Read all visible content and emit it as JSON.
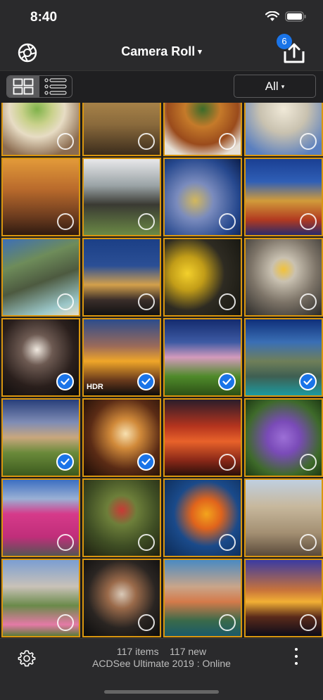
{
  "status_bar": {
    "time": "8:40"
  },
  "nav": {
    "title": "Camera Roll",
    "title_caret": "▾",
    "upload_badge": "6"
  },
  "toolbar": {
    "filter_label": "All",
    "filter_caret": "▾"
  },
  "colors": {
    "accent": "#1a74e8",
    "thumb_border": "#d9960f",
    "bar_bg": "#2a2a2c"
  },
  "thumbnails": [
    {
      "name": "salad",
      "bg": "radial-gradient(circle at 45% 40%, #7fb24a 0%, #c9d18b 25%, #e7dcc4 45%, #8b6b4f 80%)",
      "selected": false
    },
    {
      "name": "misty-temple",
      "bg": "linear-gradient(180deg, #c59b55 0%, #8a6a3c 60%, #3b2c1c 100%)",
      "selected": false
    },
    {
      "name": "noodles",
      "bg": "radial-gradient(circle at 50% 40%, #3b6b2a 0%, #c57a2a 30%, #9a4b1c 60%, #e6e0d6 85%)",
      "selected": false
    },
    {
      "name": "carved-wall",
      "bg": "radial-gradient(circle at 50% 40%, #f0e9d8 0%, #c9c2b0 40%, #5a7fbf 85%)",
      "selected": false
    },
    {
      "name": "khmer-temple",
      "bg": "linear-gradient(180deg, #e29a39 0%, #b96a2c 40%, #6e3d1f 75%, #2f1a10 100%)",
      "selected": false
    },
    {
      "name": "pagodas",
      "bg": "linear-gradient(180deg, #e8e8ea 0%, #9aa3a6 35%, #3a3a33 60%, #6b8a45 100%)",
      "selected": false
    },
    {
      "name": "coral",
      "bg": "radial-gradient(circle at 40% 55%, #d2b75d 0%, #7a8bbd 30%, #26488e 70%, #0c1e4a 100%)",
      "selected": false
    },
    {
      "name": "golden-temple",
      "bg": "linear-gradient(180deg, #1a3f93 0%, #2f5fb6 30%, #d19b3a 55%, #b23a20 80%, #2a2a6a 100%)",
      "selected": false
    },
    {
      "name": "cliffs-beach",
      "bg": "linear-gradient(160deg, #3d6fb5 0%, #6e8c5a 30%, #4d5a40 55%, #9bc7c9 85%, #e7ddc4 100%)",
      "selected": false
    },
    {
      "name": "city-night",
      "bg": "linear-gradient(180deg, #1b3f86 0%, #2b4f95 35%, #d3a04b 60%, #3a2e2a 80%, #111 100%)",
      "selected": false
    },
    {
      "name": "yellow-tulips",
      "bg": "radial-gradient(circle at 30% 45%, #f3d02c 0%, #c29d18 25%, #2e2b22 55%, #15150f 100%)",
      "selected": false
    },
    {
      "name": "owl",
      "bg": "radial-gradient(circle at 50% 40%, #f2c23a 0%, #c9c1b1 20%, #7d7468 55%, #2b2a28 100%)",
      "selected": false
    },
    {
      "name": "light-painting",
      "bg": "radial-gradient(circle at 45% 40%, #f0e9e0 0%, #6d5a52 25%, #2a1f1c 60%, #0a0a0a 100%)",
      "selected": true
    },
    {
      "name": "sunset-pier",
      "bg": "linear-gradient(180deg, #2c4c8c 0%, #9a6a5a 35%, #f0a629 55%, #6a3a1c 80%, #0c0c0c 100%)",
      "selected": true,
      "tag": "HDR"
    },
    {
      "name": "pink-tree",
      "bg": "linear-gradient(180deg, #142b6e 0%, #3d5aa3 30%, #d49bbc 50%, #4f8a2a 75%, #2c5016 100%)",
      "selected": true
    },
    {
      "name": "karst-bay",
      "bg": "linear-gradient(180deg, #0f2f7a 0%, #3a6fb5 30%, #6f7f59 55%, #3f5f52 75%, #1b9aa0 100%)",
      "selected": true
    },
    {
      "name": "village-sky",
      "bg": "linear-gradient(180deg, #283f7a 0%, #7f8cb5 30%, #c9a77d 50%, #6a8a3a 70%, #3c5a1e 100%)",
      "selected": true
    },
    {
      "name": "sky-lantern",
      "bg": "radial-gradient(circle at 55% 45%, #f7e0b0 0%, #d18a3a 25%, #5a2b15 60%, #1a0c06 100%)",
      "selected": true
    },
    {
      "name": "red-sunset",
      "bg": "linear-gradient(180deg, #2b1d2a 0%, #b5341e 35%, #e8622a 55%, #8a2818 80%, #2a0f0a 100%)",
      "selected": false
    },
    {
      "name": "purple-flowers",
      "bg": "radial-gradient(circle at 50% 50%, #9c6fd6 0%, #7a4bb8 30%, #3e6a2a 70%, #1e3a14 100%)",
      "selected": false
    },
    {
      "name": "pink-house",
      "bg": "linear-gradient(180deg, #3c6fc2 0%, #9ab0d4 25%, #d63a8a 45%, #c02e7a 75%, #555 100%)",
      "selected": false
    },
    {
      "name": "moss-statue",
      "bg": "radial-gradient(circle at 50% 40%, #c83a36 0%, #6d7f3a 25%, #3f4e24 60%, #1e2010 100%)",
      "selected": false
    },
    {
      "name": "goldfish",
      "bg": "radial-gradient(circle at 55% 45%, #f3a41c 0%, #e0641c 25%, #1a4a8a 55%, #0c2a55 100%)",
      "selected": false
    },
    {
      "name": "cathedral",
      "bg": "linear-gradient(180deg, #bfcfe0 0%, #c7b89d 35%, #a38f72 70%, #5a4a3a 100%)",
      "selected": false
    },
    {
      "name": "chateau-garden",
      "bg": "linear-gradient(180deg, #7b9ed2 0%, #c9c2b8 35%, #6a8a4a 60%, #e47aa6 85%, #5a7a3a 100%)",
      "selected": false
    },
    {
      "name": "lionfish",
      "bg": "radial-gradient(circle at 50% 45%, #d9c9b8 0%, #9a6a4a 25%, #2a2522 60%, #0c0c0c 100%)",
      "selected": false
    },
    {
      "name": "cinque-terre",
      "bg": "linear-gradient(180deg, #4a8ac2 0%, #c9a58a 35%, #d47a4a 55%, #3a6a4a 80%, #1a5a6a 100%)",
      "selected": false
    },
    {
      "name": "ocean-sunset",
      "bg": "linear-gradient(180deg, #3a3aa2 0%, #c9743a 40%, #f2b035 55%, #5a2a1a 75%, #0c0c1a 100%)",
      "selected": false
    }
  ],
  "footer": {
    "items_count": "117 items",
    "new_count": "117 new",
    "status_line": "ACDSee Ultimate 2019 : Online"
  }
}
